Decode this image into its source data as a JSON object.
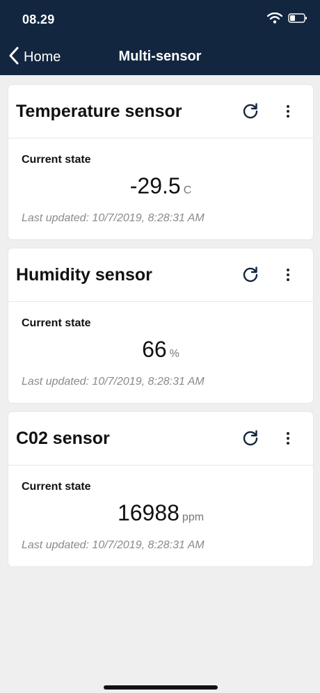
{
  "status_bar": {
    "time": "08.29"
  },
  "nav": {
    "back_label": "Home",
    "title": "Multi-sensor"
  },
  "cards": [
    {
      "title": "Temperature sensor",
      "state_label": "Current state",
      "value": "-29.5",
      "unit": "C",
      "updated": "Last updated: 10/7/2019, 8:28:31 AM"
    },
    {
      "title": "Humidity sensor",
      "state_label": "Current state",
      "value": "66",
      "unit": "%",
      "updated": "Last updated: 10/7/2019, 8:28:31 AM"
    },
    {
      "title": "C02 sensor",
      "state_label": "Current state",
      "value": "16988",
      "unit": "ppm",
      "updated": "Last updated: 10/7/2019, 8:28:31 AM"
    }
  ],
  "icons": {
    "back": "chevron-left-icon",
    "refresh": "refresh-icon",
    "more": "more-vertical-icon",
    "wifi": "wifi-icon",
    "battery": "battery-icon"
  },
  "colors": {
    "header_bg": "#12263f",
    "page_bg": "#efefef",
    "card_bg": "#ffffff"
  }
}
